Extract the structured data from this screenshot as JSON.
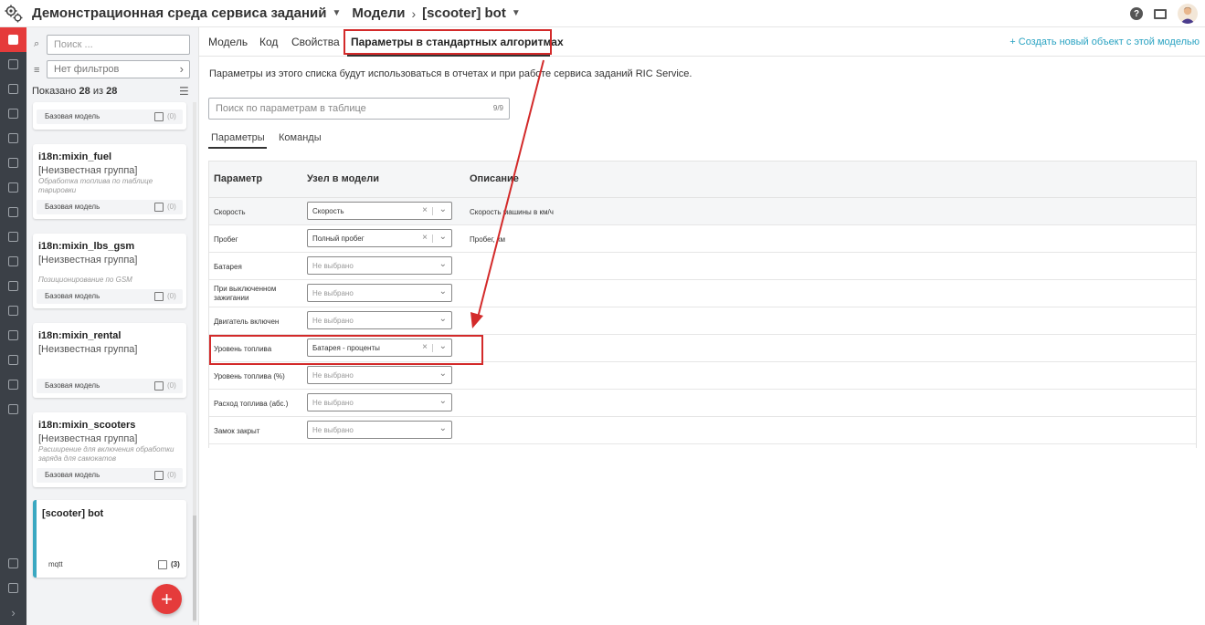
{
  "header": {
    "crumb1": "Демонстрационная среда сервиса заданий",
    "crumb2": "Модели",
    "crumb3": "[scooter] bot"
  },
  "side": {
    "search_placeholder": "Поиск ...",
    "filter_value": "Нет фильтров",
    "count_prefix": "Показано",
    "count_shown": "28",
    "count_of": "из",
    "count_total": "28",
    "cards": [
      {
        "title": "",
        "group": "",
        "desc": "",
        "foot": "Базовая модель",
        "num": "(0)"
      },
      {
        "title": "i18n:mixin_fuel",
        "group": "[Неизвестная группа]",
        "desc": "Обработка топлива по таблице тарировки",
        "foot": "Базовая модель",
        "num": "(0)"
      },
      {
        "title": "i18n:mixin_lbs_gsm",
        "group": "[Неизвестная группа]",
        "desc": "Позиционирование по GSM",
        "foot": "Базовая модель",
        "num": "(0)"
      },
      {
        "title": "i18n:mixin_rental",
        "group": "[Неизвестная группа]",
        "desc": "",
        "foot": "Базовая модель",
        "num": "(0)"
      },
      {
        "title": "i18n:mixin_scooters",
        "group": "[Неизвестная группа]",
        "desc": "Расширение для включения обработки заряда для самокатов",
        "foot": "Базовая модель",
        "num": "(0)"
      },
      {
        "title": "[scooter] bot",
        "group": "",
        "desc": "",
        "foot": "mqtt",
        "num": "(3)"
      }
    ],
    "fab": "+"
  },
  "tabs": {
    "model": "Модель",
    "code": "Код",
    "props": "Свойства",
    "params": "Параметры в стандартных алгоритмах",
    "create_link": "+ Создать новый объект с этой моделью"
  },
  "content": {
    "info": "Параметры из этого списка будут использоваться в отчетах и при работе сервиса заданий RIC Service.",
    "search_placeholder": "Поиск по параметрам в таблице",
    "search_count": "9/9",
    "subtab_params": "Параметры",
    "subtab_commands": "Команды",
    "col_param": "Параметр",
    "col_node": "Узел в модели",
    "col_desc": "Описание",
    "rows": [
      {
        "name": "Скорость",
        "value": "Скорость",
        "set": true,
        "desc": "Скорость машины в км/ч"
      },
      {
        "name": "Пробег",
        "value": "Полный пробег",
        "set": true,
        "desc": "Пробег, км"
      },
      {
        "name": "Батарея",
        "value": "Не выбрано",
        "set": false,
        "desc": ""
      },
      {
        "name": "При выключенном зажигании",
        "value": "Не выбрано",
        "set": false,
        "desc": ""
      },
      {
        "name": "Двигатель включен",
        "value": "Не выбрано",
        "set": false,
        "desc": ""
      },
      {
        "name": "Уровень топлива",
        "value": "Батарея - проценты",
        "set": true,
        "desc": ""
      },
      {
        "name": "Уровень топлива (%)",
        "value": "Не выбрано",
        "set": false,
        "desc": ""
      },
      {
        "name": "Расход топлива (абс.)",
        "value": "Не выбрано",
        "set": false,
        "desc": ""
      },
      {
        "name": "Замок закрыт",
        "value": "Не выбрано",
        "set": false,
        "desc": ""
      }
    ]
  },
  "colors": {
    "accent": "#e53b3b",
    "highlight": "#d32a2a",
    "link": "#2aa3c2",
    "selected_card": "#3aa8c1"
  }
}
